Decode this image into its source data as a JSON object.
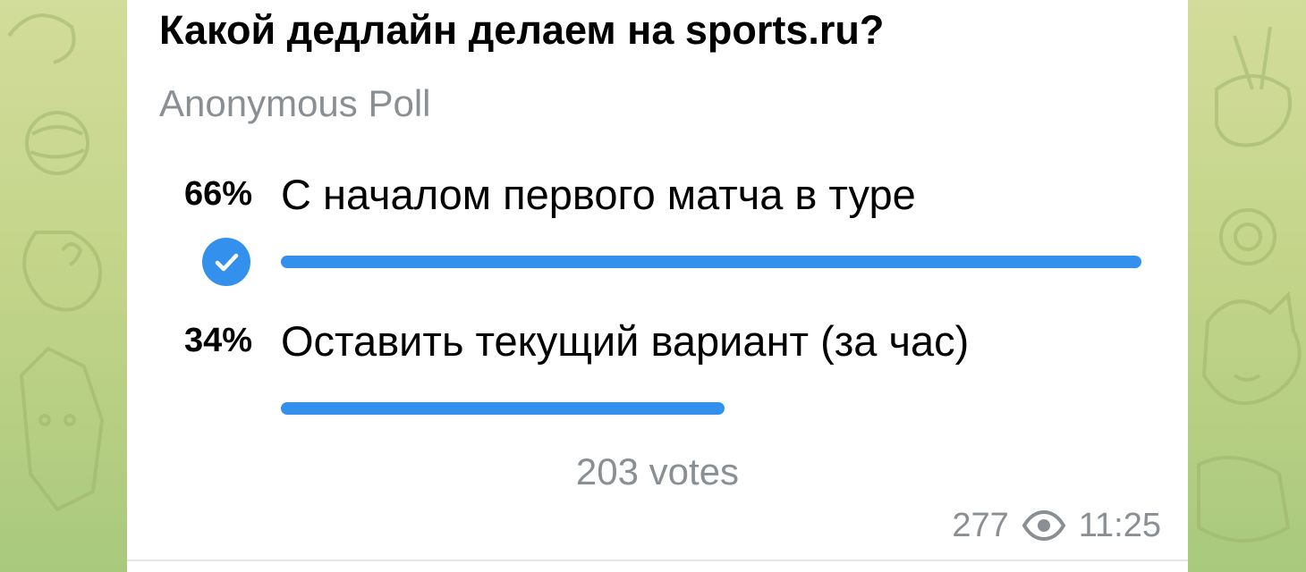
{
  "poll": {
    "question": "Какой дедлайн делаем на sports.ru?",
    "type_label": "Anonymous Poll",
    "options": [
      {
        "percent": "66%",
        "label": "С началом первого матча в туре",
        "fraction": 0.66,
        "selected": true
      },
      {
        "percent": "34%",
        "label": "Оставить текущий вариант (за час)",
        "fraction": 0.34,
        "selected": false
      }
    ],
    "votes_label": "203 votes"
  },
  "message": {
    "views": "277",
    "time": "11:25",
    "view_icon": "eye-icon",
    "check_icon": "check-circle-icon"
  },
  "colors": {
    "accent": "#3390ec",
    "secondary_text": "#8a8f94",
    "wallpaper": "#c4d58a"
  }
}
